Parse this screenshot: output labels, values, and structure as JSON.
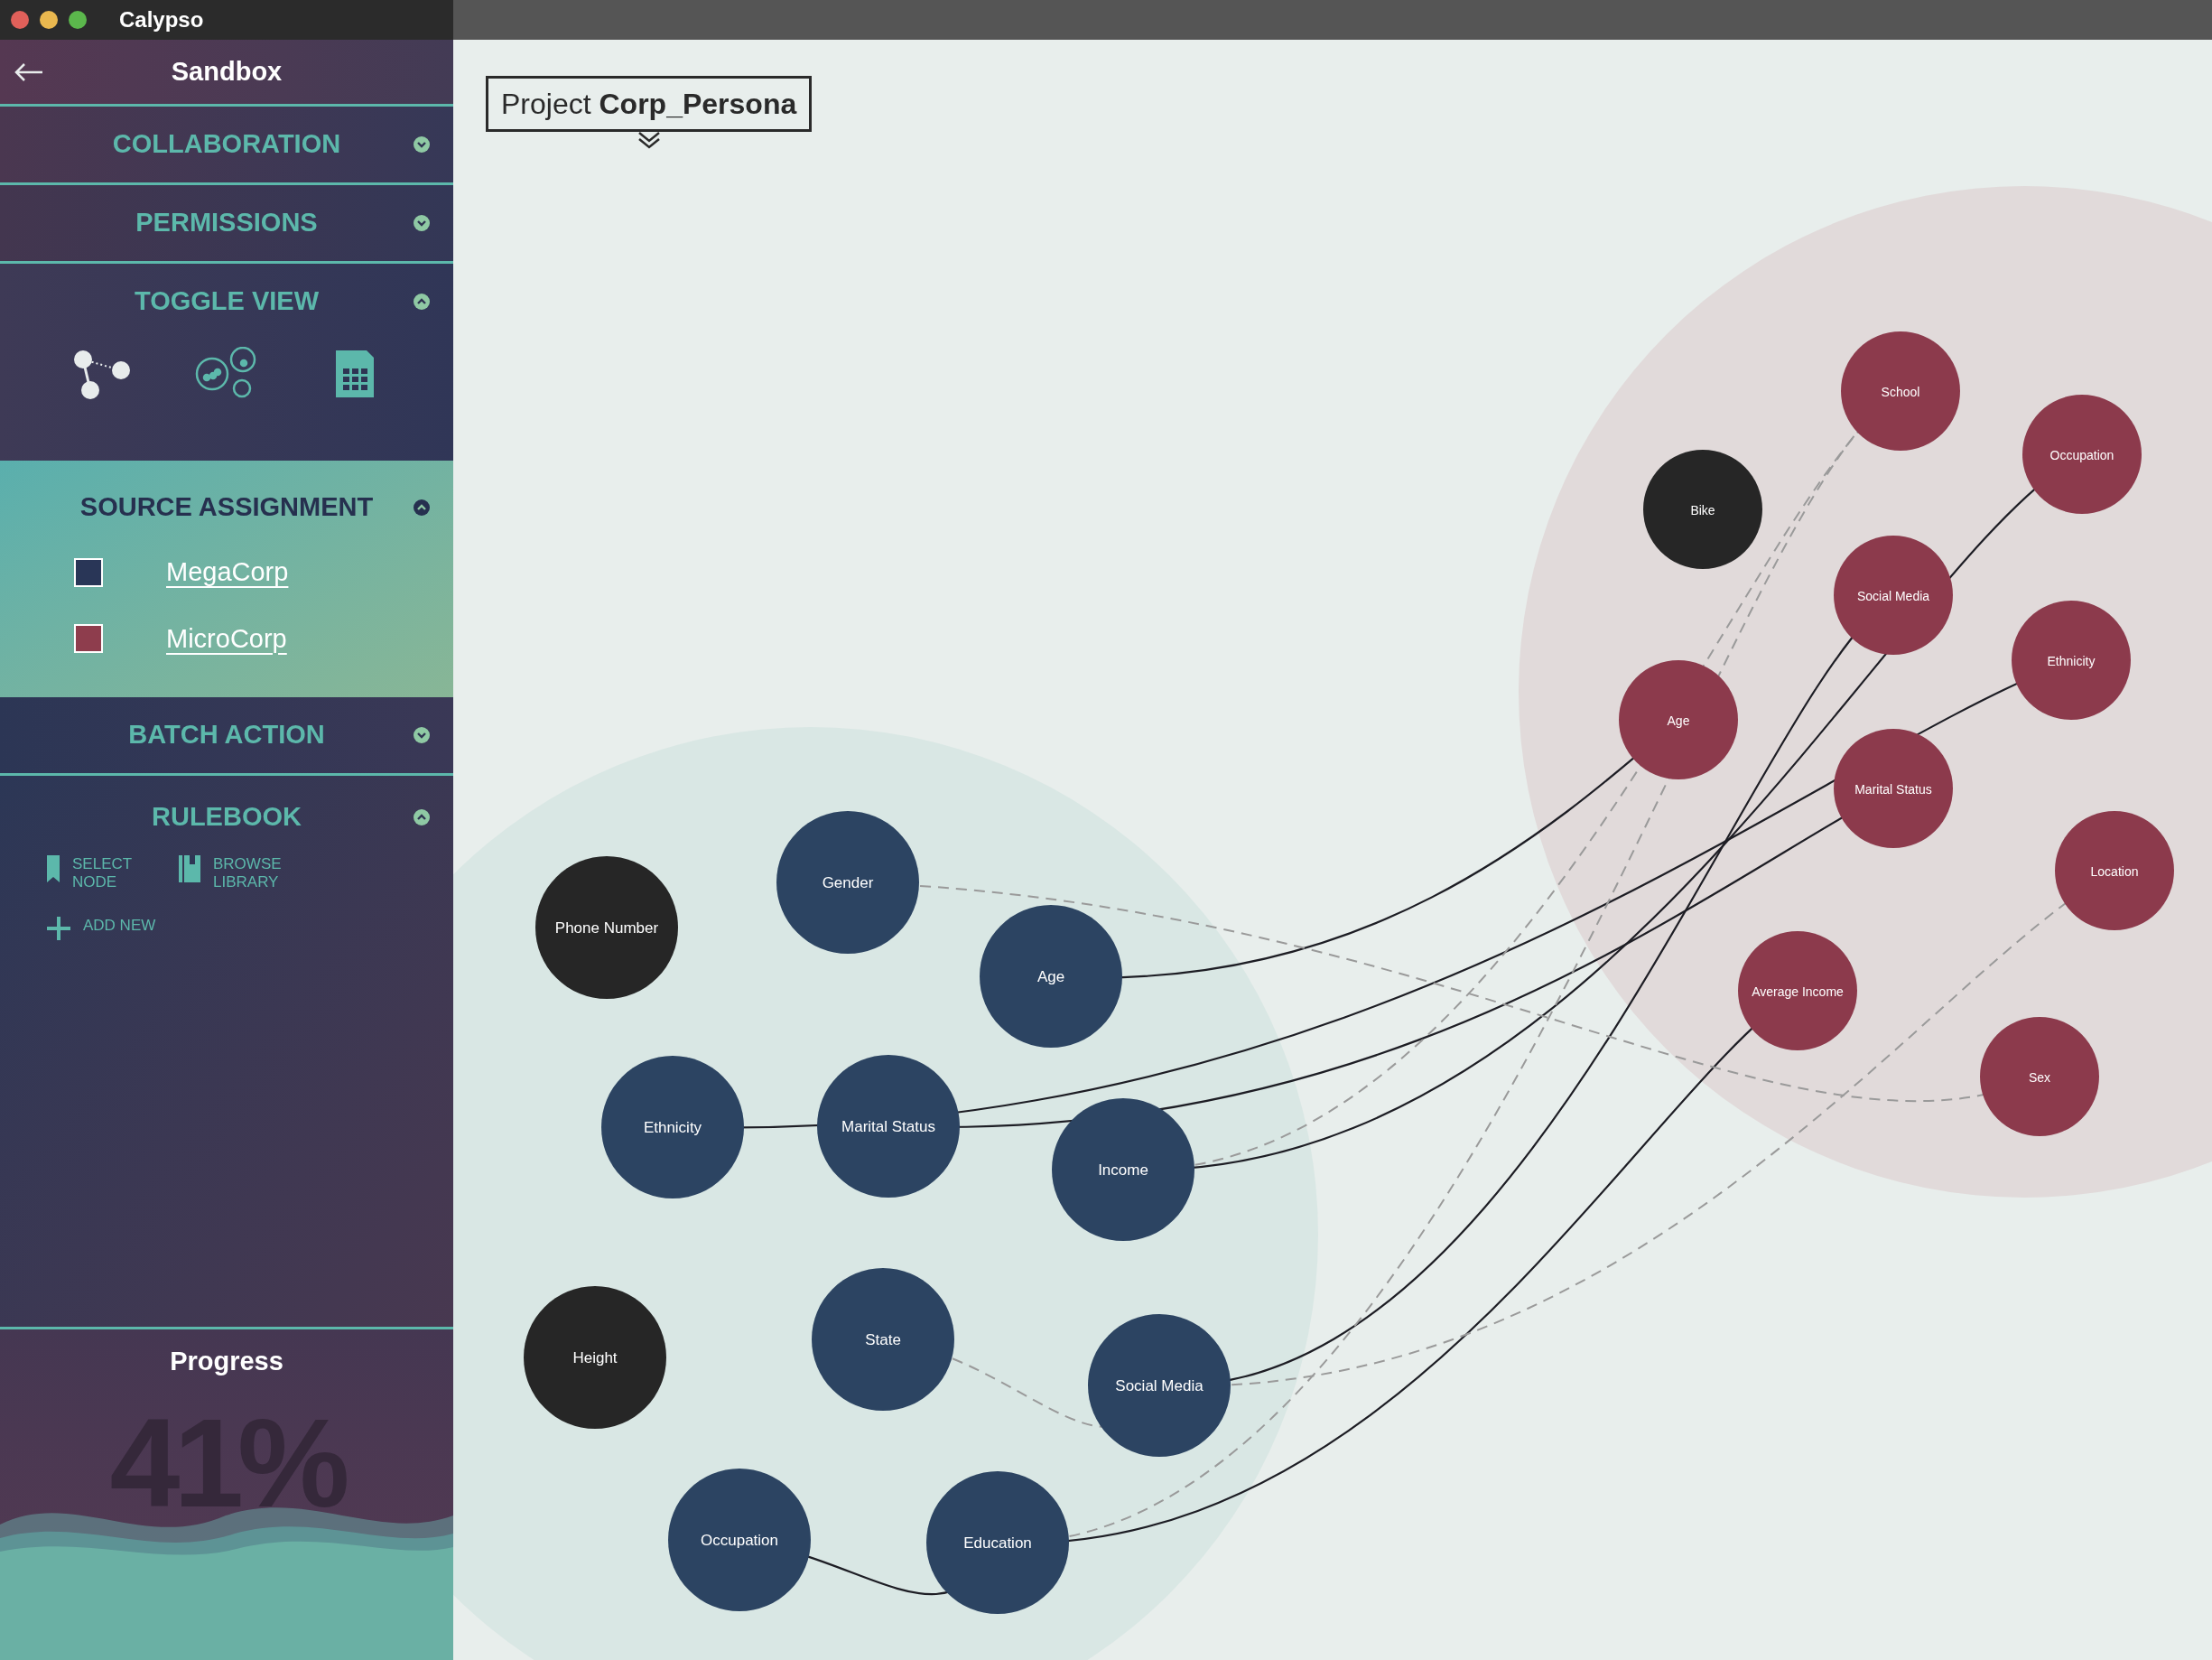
{
  "window": {
    "title": "Calypso"
  },
  "sidebar": {
    "title": "Sandbox",
    "collaboration": {
      "title": "COLLABORATION",
      "expanded": false
    },
    "permissions": {
      "title": "PERMISSIONS",
      "expanded": false
    },
    "toggle_view": {
      "title": "TOGGLE VIEW",
      "expanded": true,
      "views": [
        {
          "kind": "graph",
          "selected": true
        },
        {
          "kind": "bubbles",
          "selected": false
        },
        {
          "kind": "table",
          "selected": false
        }
      ]
    },
    "source_assignment": {
      "title": "SOURCE ASSIGNMENT",
      "expanded": true,
      "sources": [
        {
          "label": "MegaCorp",
          "color": "#293657"
        },
        {
          "label": "MicroCorp",
          "color": "#8e3d4d"
        }
      ]
    },
    "batch_action": {
      "title": "BATCH ACTION",
      "expanded": false
    },
    "rulebook": {
      "title": "RULEBOOK",
      "expanded": true,
      "actions": [
        {
          "kind": "bookmark",
          "label": "SELECT NODE"
        },
        {
          "kind": "library",
          "label": "BROWSE LIBRARY"
        },
        {
          "kind": "add",
          "label": "ADD NEW"
        }
      ]
    },
    "progress": {
      "title": "Progress",
      "value": "41%"
    }
  },
  "canvas": {
    "project_label": "Project **Corp_Persona**",
    "nodes": [
      {
        "label": "Phone Number",
        "kind": "dark"
      },
      {
        "label": "Gender",
        "kind": "mega"
      },
      {
        "label": "Age",
        "kind": "mega"
      },
      {
        "label": "Ethnicity",
        "kind": "mega"
      },
      {
        "label": "Marital Status",
        "kind": "mega"
      },
      {
        "label": "Income",
        "kind": "mega"
      },
      {
        "label": "Height",
        "kind": "dark"
      },
      {
        "label": "State",
        "kind": "mega"
      },
      {
        "label": "Social Media",
        "kind": "mega"
      },
      {
        "label": "Occupation",
        "kind": "mega"
      },
      {
        "label": "Education",
        "kind": "mega"
      },
      {
        "label": "School",
        "kind": "micro"
      },
      {
        "label": "Occupation",
        "kind": "micro"
      },
      {
        "label": "Bike",
        "kind": "dark"
      },
      {
        "label": "Social Media",
        "kind": "micro"
      },
      {
        "label": "Ethnicity",
        "kind": "micro"
      },
      {
        "label": "Age",
        "kind": "micro"
      },
      {
        "label": "Marital Status",
        "kind": "micro"
      },
      {
        "label": "Location",
        "kind": "micro"
      },
      {
        "label": "Average Income",
        "kind": "micro"
      },
      {
        "label": "Sex",
        "kind": "micro"
      }
    ]
  }
}
